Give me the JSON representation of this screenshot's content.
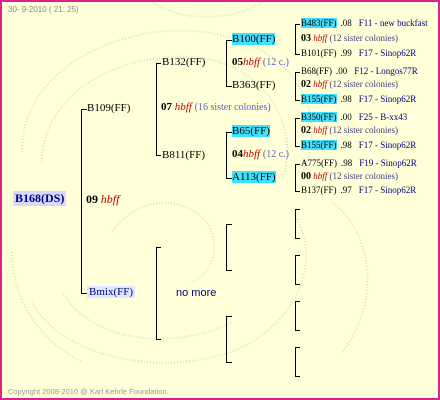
{
  "header": {
    "date_line": "30-  9-2010 ( 21: 25)"
  },
  "footer": {
    "copyright": "Copyright 2008-2010 @ Karl Kehrle Foundation."
  },
  "root": {
    "label": "B168(DS)"
  },
  "gen1": {
    "number": "09",
    "code": "hbff"
  },
  "parents": {
    "upper": "B109(FF)",
    "lower": "Bmix(FF)",
    "no_more": "no more"
  },
  "gen2": {
    "number": "07",
    "code": "hbff",
    "sisters": "(16 sister colonies)"
  },
  "grandparents": {
    "upper": "B132(FF)",
    "lower": "B811(FF)"
  },
  "gen3a": {
    "number": "05",
    "code": "hbff",
    "sisters": "(12 c.)"
  },
  "gen3b": {
    "number": "04",
    "code": "hbff",
    "sisters": "(12 c.)"
  },
  "ggp": [
    "B100(FF)",
    "B363(FF)",
    "B65(FF)",
    "A113(FF)"
  ],
  "gen4": [
    {
      "number": "03",
      "code": "hbff",
      "sisters": "(12 sister colonies)"
    },
    {
      "number": "02",
      "code": "hbff",
      "sisters": "(12 sister colonies)"
    },
    {
      "number": "02",
      "code": "hbff",
      "sisters": "(12 sister colonies)"
    },
    {
      "number": "00",
      "code": "hbff",
      "sisters": "(12 sister colonies)"
    }
  ],
  "ancestors": [
    {
      "label": "B483(FF)",
      "value": ".08",
      "source": "F11 - new buckfast"
    },
    {
      "label": "B101(FF)",
      "value": ".99",
      "source": "F17 - Sinop62R"
    },
    {
      "label": "B68(FF)",
      "value": ".00",
      "source": "F12 - Longos77R"
    },
    {
      "label": "B155(FF)",
      "value": ".98",
      "source": "F17 - Sinop62R"
    },
    {
      "label": "B350(FF)",
      "value": ".00",
      "source": "F25 - B-xx43"
    },
    {
      "label": "B155(FF)",
      "value": ".98",
      "source": "F17 - Sinop62R"
    },
    {
      "label": "A775(FF)",
      "value": ".98",
      "source": "F19 - Sinop62R"
    },
    {
      "label": "B137(FF)",
      "value": ".97",
      "source": "F17 - Sinop62R"
    }
  ]
}
